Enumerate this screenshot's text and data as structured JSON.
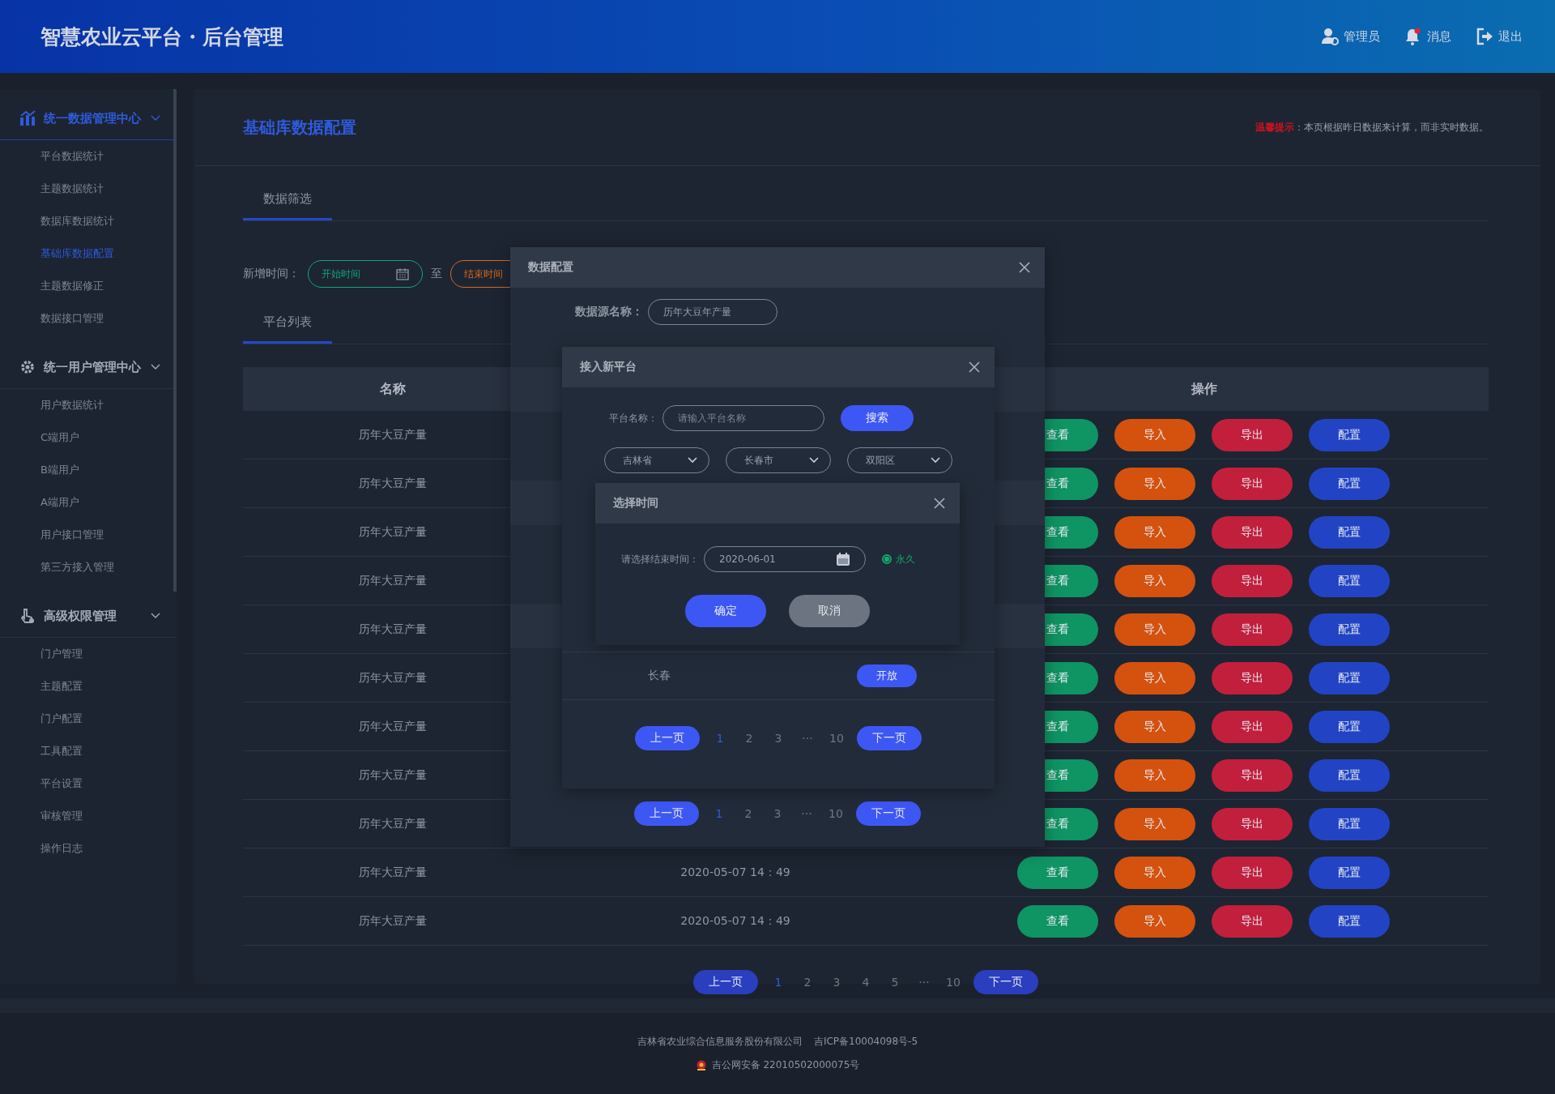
{
  "header": {
    "title": "智慧农业云平台・后台管理",
    "actions": [
      {
        "kind": "user",
        "label": "管理员"
      },
      {
        "kind": "bell",
        "label": "消息"
      },
      {
        "kind": "exit",
        "label": "退出"
      }
    ]
  },
  "sidebar": {
    "groups": [
      {
        "kind": "chart",
        "title": "统一数据管理中心",
        "selected": true,
        "expanded": true,
        "items": [
          {
            "label": "平台数据统计",
            "selected": false
          },
          {
            "label": "主题数据统计",
            "selected": false
          },
          {
            "label": "数据库数据统计",
            "selected": false
          },
          {
            "label": "基础库数据配置",
            "selected": true
          },
          {
            "label": "主题数据修正",
            "selected": false
          },
          {
            "label": "数据接口管理",
            "selected": false
          }
        ]
      },
      {
        "kind": "gear",
        "title": "统一用户管理中心",
        "selected": false,
        "expanded": true,
        "items": [
          {
            "label": "用户数据统计",
            "selected": false
          },
          {
            "label": "C端用户",
            "selected": false
          },
          {
            "label": "B端用户",
            "selected": false
          },
          {
            "label": "A端用户",
            "selected": false
          },
          {
            "label": "用户接口管理",
            "selected": false
          },
          {
            "label": "第三方接入管理",
            "selected": false
          }
        ]
      },
      {
        "kind": "hand",
        "title": "高级权限管理",
        "selected": false,
        "expanded": true,
        "items": [
          {
            "label": "门户管理",
            "selected": false
          },
          {
            "label": "主题配置",
            "selected": false
          },
          {
            "label": "门户配置",
            "selected": false
          },
          {
            "label": "工具配置",
            "selected": false
          },
          {
            "label": "平台设置",
            "selected": false
          },
          {
            "label": "审核管理",
            "selected": false
          },
          {
            "label": "操作日志",
            "selected": false
          }
        ]
      }
    ]
  },
  "page": {
    "title": "基础库数据配置",
    "notice": {
      "label": "温馨提示",
      "text": "：本页根据昨日数据来计算，而非实时数据。"
    },
    "filter_tab": "数据筛选",
    "filter": {
      "label": "新增时间：",
      "start": {
        "placeholder": "开始时间"
      },
      "separator": "至",
      "end": {
        "placeholder": "结束时间"
      }
    },
    "list_tab": "平台列表",
    "table": {
      "name_heading": "名称",
      "actions_heading": "操作",
      "rows": [
        {
          "name": "历年大豆产量",
          "actions": [
            {
              "kind": "view",
              "label": "查看"
            },
            {
              "kind": "import",
              "label": "导入"
            },
            {
              "kind": "export",
              "label": "导出"
            },
            {
              "kind": "config",
              "label": "配置"
            }
          ]
        },
        {
          "name": "历年大豆产量",
          "actions": [
            {
              "kind": "view",
              "label": "查看"
            },
            {
              "kind": "import",
              "label": "导入"
            },
            {
              "kind": "export",
              "label": "导出"
            },
            {
              "kind": "config",
              "label": "配置"
            }
          ]
        },
        {
          "name": "历年大豆产量",
          "actions": [
            {
              "kind": "view",
              "label": "查看"
            },
            {
              "kind": "import",
              "label": "导入"
            },
            {
              "kind": "export",
              "label": "导出"
            },
            {
              "kind": "config",
              "label": "配置"
            }
          ]
        },
        {
          "name": "历年大豆产量",
          "actions": [
            {
              "kind": "view",
              "label": "查看"
            },
            {
              "kind": "import",
              "label": "导入"
            },
            {
              "kind": "export",
              "label": "导出"
            },
            {
              "kind": "config",
              "label": "配置"
            }
          ]
        },
        {
          "name": "历年大豆产量",
          "actions": [
            {
              "kind": "view",
              "label": "查看"
            },
            {
              "kind": "import",
              "label": "导入"
            },
            {
              "kind": "export",
              "label": "导出"
            },
            {
              "kind": "config",
              "label": "配置"
            }
          ]
        },
        {
          "name": "历年大豆产量",
          "actions": [
            {
              "kind": "view",
              "label": "查看"
            },
            {
              "kind": "import",
              "label": "导入"
            },
            {
              "kind": "export",
              "label": "导出"
            },
            {
              "kind": "config",
              "label": "配置"
            }
          ]
        },
        {
          "name": "历年大豆产量",
          "actions": [
            {
              "kind": "view",
              "label": "查看"
            },
            {
              "kind": "import",
              "label": "导入"
            },
            {
              "kind": "export",
              "label": "导出"
            },
            {
              "kind": "config",
              "label": "配置"
            }
          ]
        },
        {
          "name": "历年大豆产量",
          "actions": [
            {
              "kind": "view",
              "label": "查看"
            },
            {
              "kind": "import",
              "label": "导入"
            },
            {
              "kind": "export",
              "label": "导出"
            },
            {
              "kind": "config",
              "label": "配置"
            }
          ]
        },
        {
          "name": "历年大豆产量",
          "actions": [
            {
              "kind": "view",
              "label": "查看"
            },
            {
              "kind": "import",
              "label": "导入"
            },
            {
              "kind": "export",
              "label": "导出"
            },
            {
              "kind": "config",
              "label": "配置"
            }
          ]
        },
        {
          "name": "历年大豆产量",
          "time": "2020-05-07  14：49",
          "actions": [
            {
              "kind": "view",
              "label": "查看"
            },
            {
              "kind": "import",
              "label": "导入"
            },
            {
              "kind": "export",
              "label": "导出"
            },
            {
              "kind": "config",
              "label": "配置"
            }
          ]
        },
        {
          "name": "历年大豆产量",
          "time": "2020-05-07  14：49",
          "actions": [
            {
              "kind": "view",
              "label": "查看"
            },
            {
              "kind": "import",
              "label": "导入"
            },
            {
              "kind": "export",
              "label": "导出"
            },
            {
              "kind": "config",
              "label": "配置"
            }
          ]
        }
      ]
    },
    "pagination": {
      "prev": "上一页",
      "next": "下一页",
      "pages": [
        {
          "label": "1",
          "selected": true
        },
        {
          "label": "2",
          "selected": false
        },
        {
          "label": "3",
          "selected": false
        },
        {
          "label": "4",
          "selected": false
        },
        {
          "label": "5",
          "selected": false
        },
        {
          "label": "···",
          "selected": false
        },
        {
          "label": "10",
          "selected": false
        }
      ]
    }
  },
  "data_config_dialog": {
    "title": "数据配置",
    "field_label": "数据源名称：",
    "field_value": "历年大豆年产量",
    "pagination": {
      "prev": "上一页",
      "next": "下一页",
      "pages": [
        {
          "label": "1",
          "selected": true
        },
        {
          "label": "2",
          "selected": false
        },
        {
          "label": "3",
          "selected": false
        },
        {
          "label": "···",
          "selected": false
        },
        {
          "label": "10",
          "selected": false
        }
      ]
    }
  },
  "platform_dialog": {
    "title": "接入新平台",
    "search_label": "平台名称：",
    "search_placeholder": "请输入平台名称",
    "search_button": "搜索",
    "selects": [
      "吉林省",
      "长春市",
      "双阳区"
    ],
    "rows": [
      {
        "name": "长春",
        "action": "开放"
      }
    ],
    "pagination": {
      "prev": "上一页",
      "next": "下一页",
      "pages": [
        {
          "label": "1",
          "selected": true
        },
        {
          "label": "2",
          "selected": false
        },
        {
          "label": "3",
          "selected": false
        },
        {
          "label": "···",
          "selected": false
        },
        {
          "label": "10",
          "selected": false
        }
      ]
    }
  },
  "time_dialog": {
    "title": "选择时间",
    "label": "请选择结束时间：",
    "date_value": "2020-06-01",
    "option": {
      "label": "永久",
      "selected": true
    },
    "buttons": [
      {
        "kind": "primary",
        "label": "确定"
      },
      {
        "kind": "secondary",
        "label": "取消"
      }
    ]
  },
  "footer": {
    "company": "吉林省农业综合信息服务股份有限公司",
    "icp": "吉ICP备10004098号-5",
    "police": "吉公网安备 22010502000075号"
  }
}
